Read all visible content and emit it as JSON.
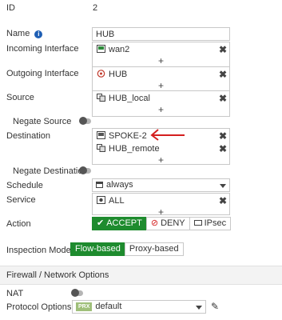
{
  "form": {
    "id_label": "ID",
    "id_value": "2",
    "name_label": "Name",
    "name_value": "HUB",
    "incoming_label": "Incoming Interface",
    "incoming_items": [
      {
        "label": "wan2"
      }
    ],
    "outgoing_label": "Outgoing Interface",
    "outgoing_items": [
      {
        "label": "HUB"
      }
    ],
    "source_label": "Source",
    "source_items": [
      {
        "label": "HUB_local"
      }
    ],
    "negate_source_label": "Negate Source",
    "destination_label": "Destination",
    "destination_items": [
      {
        "label": "SPOKE-2"
      },
      {
        "label": "HUB_remote"
      }
    ],
    "negate_destination_label": "Negate Destination",
    "schedule_label": "Schedule",
    "schedule_value": "always",
    "service_label": "Service",
    "service_items": [
      {
        "label": "ALL"
      }
    ],
    "action_label": "Action",
    "action_options": [
      {
        "label": "ACCEPT",
        "selected": true
      },
      {
        "label": "DENY",
        "selected": false
      },
      {
        "label": "IPsec",
        "selected": false
      }
    ],
    "inspection_label": "Inspection Mode",
    "inspection_options": [
      {
        "label": "Flow-based",
        "selected": true
      },
      {
        "label": "Proxy-based",
        "selected": false
      }
    ]
  },
  "section": {
    "title": "Firewall / Network Options",
    "nat_label": "NAT",
    "protocol_label": "Protocol Options",
    "protocol_badge": "PRX",
    "protocol_value": "default"
  },
  "colors": {
    "accent_green": "#1e8b2e",
    "annotation_red": "#d41f1f",
    "info_blue": "#1f5fb4"
  }
}
